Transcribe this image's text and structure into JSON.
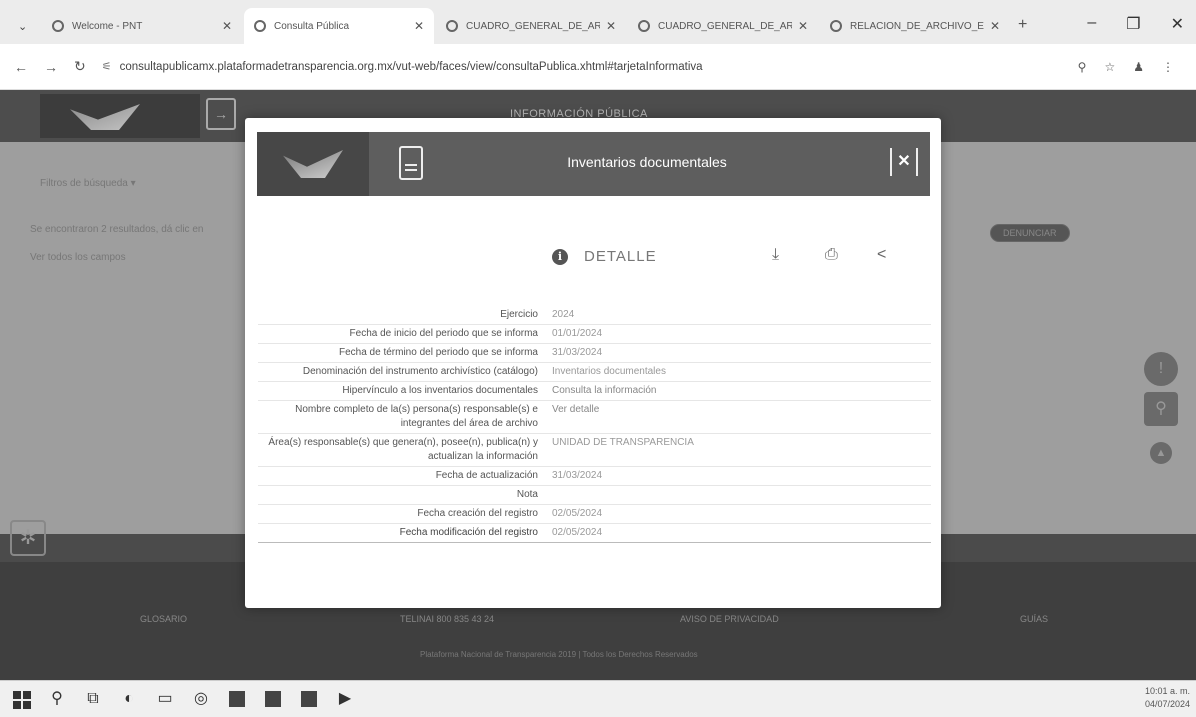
{
  "browser": {
    "tabs": [
      {
        "title": "Welcome - PNT",
        "active": false
      },
      {
        "title": "Consulta Pública",
        "active": true
      },
      {
        "title": "CUADRO_GENERAL_DE_AR",
        "active": false
      },
      {
        "title": "CUADRO_GENERAL_DE_AR",
        "active": false
      },
      {
        "title": "RELACION_DE_ARCHIVO_E",
        "active": false
      }
    ],
    "url": "consultapublicamx.plataformadetransparencia.org.mx/vut-web/faces/view/consultaPublica.xhtml#tarjetaInformativa"
  },
  "page": {
    "header_title": "INFORMACIÓN PÚBLICA",
    "filters_label": "Filtros de búsqueda ▾",
    "results_text": "Se encontraron 2 resultados, dá clic en",
    "see_all": "Ver todos los campos",
    "denunciar": "DENUNCIAR",
    "footer": {
      "glosario": "GLOSARIO",
      "telinai": "TELINAI 800 835 43 24",
      "aviso": "AVISO DE PRIVACIDAD",
      "guias": "GUÍAS",
      "copyright": "Plataforma Nacional de Transparencia 2019 | Todos los Derechos Reservados"
    }
  },
  "modal": {
    "title": "Inventarios documentales",
    "detail_label": "DETALLE",
    "rows": [
      {
        "label": "Ejercicio",
        "value": "2024"
      },
      {
        "label": "Fecha de inicio del periodo que se informa",
        "value": "01/01/2024"
      },
      {
        "label": "Fecha de término del periodo que se informa",
        "value": "31/03/2024"
      },
      {
        "label": "Denominación del instrumento archivístico (catálogo)",
        "value": "Inventarios documentales"
      },
      {
        "label": "Hipervínculo a los inventarios documentales",
        "value": "Consulta la información"
      },
      {
        "label": "Nombre completo de la(s) persona(s) responsable(s) e integrantes del área de archivo",
        "value": "Ver detalle"
      },
      {
        "label": "Área(s) responsable(s) que genera(n), posee(n), publica(n) y actualizan la información",
        "value": "UNIDAD DE TRANSPARENCIA"
      },
      {
        "label": "Fecha de actualización",
        "value": "31/03/2024"
      },
      {
        "label": "Nota",
        "value": ""
      },
      {
        "label": "Fecha creación del registro",
        "value": "02/05/2024"
      },
      {
        "label": "Fecha modificación del registro",
        "value": "02/05/2024"
      }
    ]
  },
  "taskbar": {
    "time": "10:01 a. m.",
    "date": "04/07/2024"
  }
}
